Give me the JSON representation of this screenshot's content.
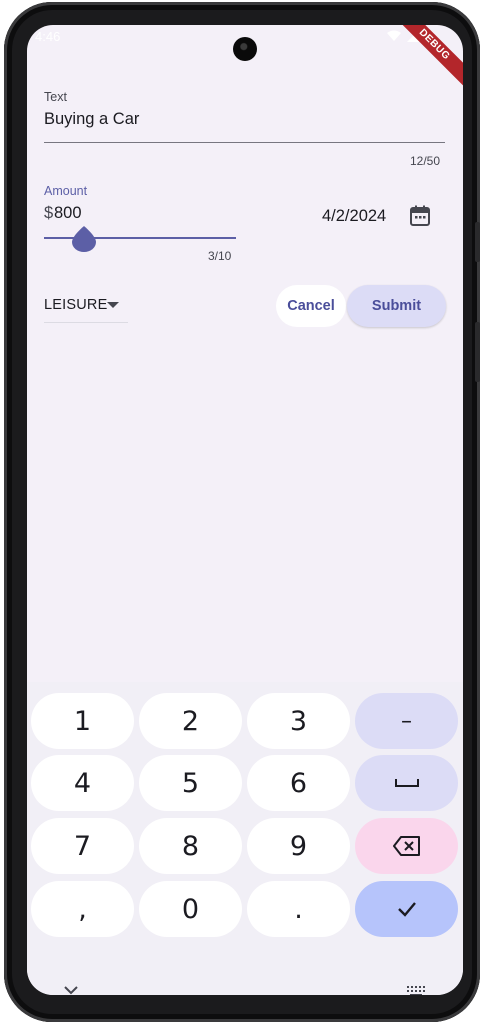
{
  "status_bar": {
    "time": "4:46"
  },
  "debug_banner": "DEBUG",
  "form": {
    "text_field": {
      "label": "Text",
      "value": "Buying a Car",
      "counter": "12/50"
    },
    "amount_field": {
      "label": "Amount",
      "prefix": "$",
      "value": "800",
      "counter": "3/10"
    },
    "date": {
      "value": "4/2/2024"
    },
    "category": {
      "selected": "LEISURE"
    },
    "buttons": {
      "cancel_label": "Cancel",
      "submit_label": "Submit"
    }
  },
  "keyboard": {
    "rows": [
      [
        "1",
        "2",
        "3",
        "–"
      ],
      [
        "4",
        "5",
        "6",
        "␣"
      ],
      [
        "7",
        "8",
        "9",
        "⌫"
      ],
      [
        ",",
        "0",
        ".",
        "✓"
      ]
    ]
  },
  "colors": {
    "accent": "#5c5fa6",
    "background": "#f4f0f8",
    "submit_bg": "#dcdcf6",
    "delete_key_bg": "#fad6ec",
    "done_key_bg": "#b6c4fb"
  }
}
